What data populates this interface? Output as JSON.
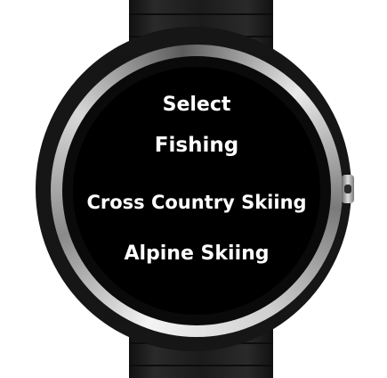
{
  "menu": {
    "title": "Select",
    "items": [
      {
        "label": "Fishing"
      },
      {
        "label": "Cross Country Skiing"
      },
      {
        "label": "Alpine Skiing"
      }
    ]
  },
  "colors": {
    "screen_background": "#000000",
    "text": "#ffffff",
    "strap": "#1a1a1a",
    "bezel": "#c8c8c8"
  },
  "icons": {
    "side_button": "side-button"
  }
}
